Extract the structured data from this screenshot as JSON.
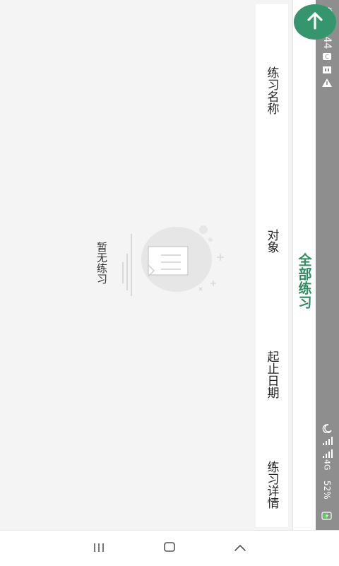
{
  "status_bar": {
    "time": "傍晚6:44",
    "network": "4G",
    "battery": "52%",
    "icons": [
      "c-icon",
      "bb-icon",
      "warning-icon",
      "moon-icon",
      "signal-icon",
      "signal-icon",
      "battery-charging-icon"
    ]
  },
  "header": {
    "title": "全部练习",
    "back_icon": "arrow-up-icon",
    "accent_color": "#35966d"
  },
  "table": {
    "columns": [
      "练习名称",
      "对象",
      "起止日期",
      "练习详情"
    ]
  },
  "empty_state": {
    "icon": "empty-document-icon",
    "message": "暂无练习"
  },
  "nav_bar": {
    "icons": [
      "recent-apps-icon",
      "home-icon",
      "back-icon"
    ]
  }
}
